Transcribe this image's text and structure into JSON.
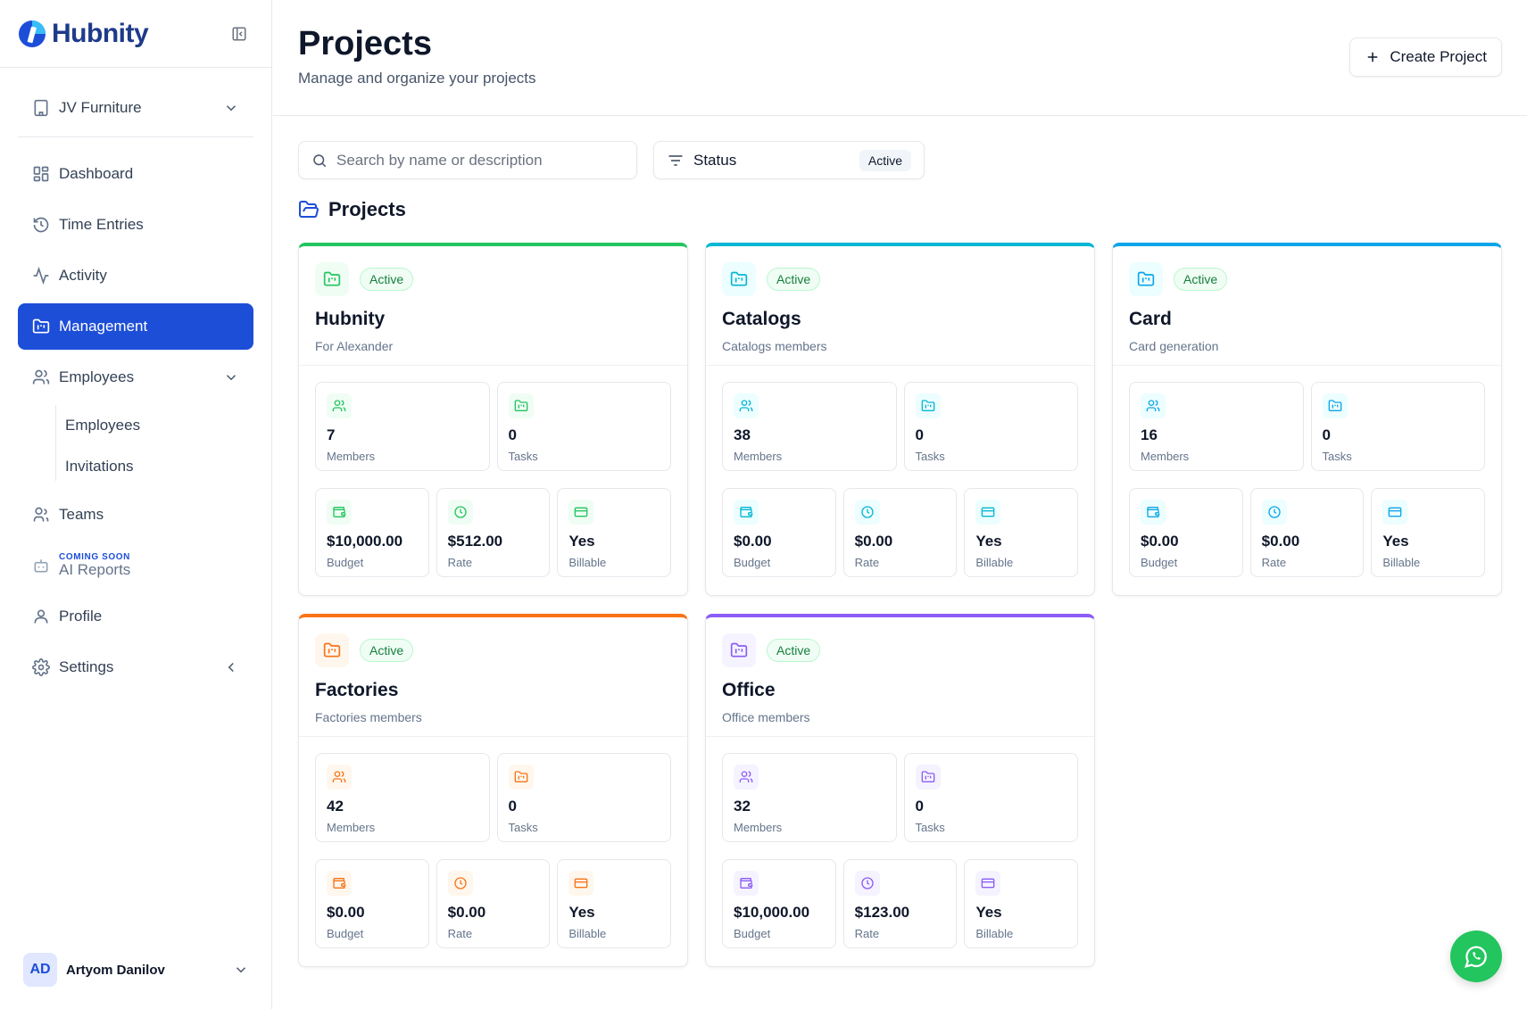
{
  "app": {
    "name": "Hubnity"
  },
  "org": {
    "name": "JV Furniture"
  },
  "nav": {
    "dashboard": "Dashboard",
    "time_entries": "Time Entries",
    "activity": "Activity",
    "management": "Management",
    "employees": "Employees",
    "employees_sub": "Employees",
    "invitations": "Invitations",
    "teams": "Teams",
    "coming_soon": "COMING SOON",
    "ai_reports": "AI Reports",
    "profile": "Profile",
    "settings": "Settings"
  },
  "user": {
    "initials": "AD",
    "name": "Artyom Danilov"
  },
  "header": {
    "title": "Projects",
    "subtitle": "Manage and organize your projects",
    "create_label": "Create Project"
  },
  "filters": {
    "search_placeholder": "Search by name or description",
    "status_label": "Status",
    "status_value": "Active"
  },
  "section": {
    "title": "Projects"
  },
  "labels": {
    "members": "Members",
    "tasks": "Tasks",
    "budget": "Budget",
    "rate": "Rate",
    "billable": "Billable"
  },
  "projects": [
    {
      "name": "Hubnity",
      "description": "For Alexander",
      "status": "Active",
      "members": "7",
      "tasks": "0",
      "budget": "$10,000.00",
      "rate": "$512.00",
      "billable": "Yes",
      "color": "#22c55e",
      "tint": "#f0fdf4",
      "icon_color": "#22c55e"
    },
    {
      "name": "Catalogs",
      "description": "Catalogs members",
      "status": "Active",
      "members": "38",
      "tasks": "0",
      "budget": "$0.00",
      "rate": "$0.00",
      "billable": "Yes",
      "color": "#06b6d4",
      "tint": "#ecfeff",
      "icon_color": "#06b6d4"
    },
    {
      "name": "Card",
      "description": "Card generation",
      "status": "Active",
      "members": "16",
      "tasks": "0",
      "budget": "$0.00",
      "rate": "$0.00",
      "billable": "Yes",
      "color": "#0ea5e9",
      "tint": "#ecfeff",
      "icon_color": "#0ea5e9"
    },
    {
      "name": "Factories",
      "description": "Factories members",
      "status": "Active",
      "members": "42",
      "tasks": "0",
      "budget": "$0.00",
      "rate": "$0.00",
      "billable": "Yes",
      "color": "#f97316",
      "tint": "#fff7ed",
      "icon_color": "#f97316"
    },
    {
      "name": "Office",
      "description": "Office members",
      "status": "Active",
      "members": "32",
      "tasks": "0",
      "budget": "$10,000.00",
      "rate": "$123.00",
      "billable": "Yes",
      "color": "#8b5cf6",
      "tint": "#f5f3ff",
      "icon_color": "#8b5cf6"
    }
  ],
  "colors": {
    "accent": "#1d4ed8",
    "whatsapp": "#22c55e"
  }
}
